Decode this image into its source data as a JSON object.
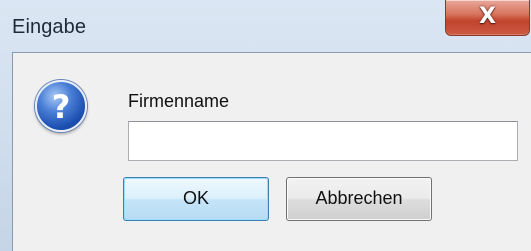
{
  "window": {
    "title": "Eingabe",
    "close_glyph": "X"
  },
  "dialog": {
    "icon": "question-icon",
    "icon_glyph": "?",
    "prompt": "Firmenname",
    "input_value": "",
    "input_placeholder": "",
    "ok_label": "OK",
    "cancel_label": "Abbrechen"
  },
  "colors": {
    "window_frame": "#c7d6e6",
    "client_background": "#f0f0f0",
    "close_button": "#c2432c",
    "default_button_border": "#3c7fb1"
  }
}
